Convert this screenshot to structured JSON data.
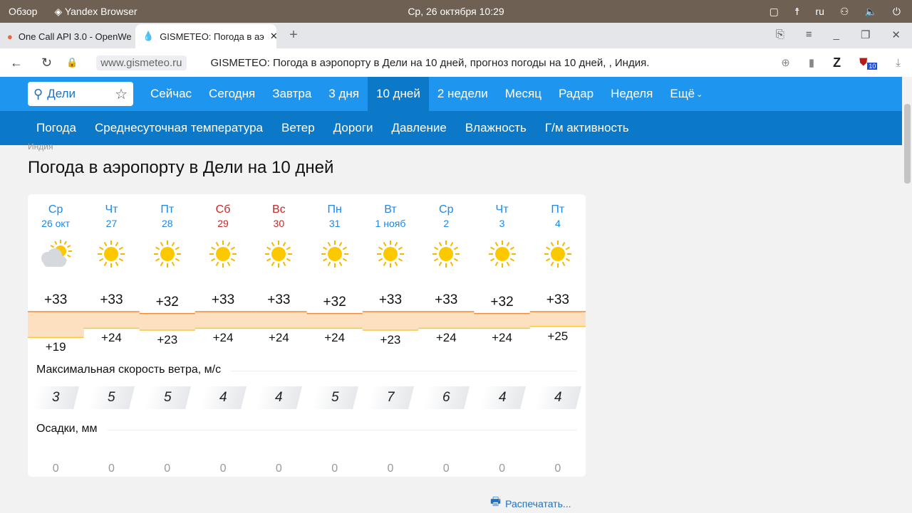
{
  "system": {
    "overview": "Обзор",
    "app": "Yandex Browser",
    "datetime": "Ср, 26 октября  10:29",
    "lang": "ru"
  },
  "tabs": [
    {
      "label": "One Call API 3.0 - OpenWe"
    },
    {
      "label": "GISMETEO: Погода в аэ"
    }
  ],
  "address": {
    "url": "www.gismeteo.ru",
    "page_title": "GISMETEO: Погода в аэропорту в Дели на 10 дней, прогноз погоды на 10 дней, , Индия.",
    "ext_badge": "10",
    "ext_z": "Z"
  },
  "nav1": {
    "search_value": "Дели",
    "items": [
      "Сейчас",
      "Сегодня",
      "Завтра",
      "3 дня",
      "10 дней",
      "2 недели",
      "Месяц",
      "Радар",
      "Неделя",
      "Ещё"
    ],
    "selected": "10 дней"
  },
  "nav2": {
    "items": [
      "Погода",
      "Среднесуточная температура",
      "Ветер",
      "Дороги",
      "Давление",
      "Влажность",
      "Г/м активность"
    ]
  },
  "breadcrumb": "Индия",
  "title": "Погода в аэропорту в Дели на 10 дней",
  "forecast": {
    "days": [
      {
        "name": "Ср",
        "date": "26 окт",
        "weekend": false,
        "icon": "partly-cloudy-icon",
        "tmax": "+33",
        "tmin": "+19",
        "wind": "3",
        "precip": "0"
      },
      {
        "name": "Чт",
        "date": "27",
        "weekend": false,
        "icon": "sun-icon",
        "tmax": "+33",
        "tmin": "+24",
        "wind": "5",
        "precip": "0"
      },
      {
        "name": "Пт",
        "date": "28",
        "weekend": false,
        "icon": "sun-icon",
        "tmax": "+32",
        "tmin": "+23",
        "wind": "5",
        "precip": "0"
      },
      {
        "name": "Сб",
        "date": "29",
        "weekend": true,
        "icon": "sun-icon",
        "tmax": "+33",
        "tmin": "+24",
        "wind": "4",
        "precip": "0"
      },
      {
        "name": "Вс",
        "date": "30",
        "weekend": true,
        "icon": "sun-icon",
        "tmax": "+33",
        "tmin": "+24",
        "wind": "4",
        "precip": "0"
      },
      {
        "name": "Пн",
        "date": "31",
        "weekend": false,
        "icon": "sun-icon",
        "tmax": "+32",
        "tmin": "+24",
        "wind": "5",
        "precip": "0"
      },
      {
        "name": "Вт",
        "date": "1 нояб",
        "weekend": false,
        "icon": "sun-icon",
        "tmax": "+33",
        "tmin": "+23",
        "wind": "7",
        "precip": "0"
      },
      {
        "name": "Ср",
        "date": "2",
        "weekend": false,
        "icon": "sun-icon",
        "tmax": "+33",
        "tmin": "+24",
        "wind": "6",
        "precip": "0"
      },
      {
        "name": "Чт",
        "date": "3",
        "weekend": false,
        "icon": "sun-icon",
        "tmax": "+32",
        "tmin": "+24",
        "wind": "4",
        "precip": "0"
      },
      {
        "name": "Пт",
        "date": "4",
        "weekend": false,
        "icon": "sun-icon",
        "tmax": "+33",
        "tmin": "+25",
        "wind": "4",
        "precip": "0"
      }
    ],
    "wind_label": "Максимальная скорость ветра, м/с",
    "precip_label": "Осадки, мм"
  },
  "print_label": "Распечатать...",
  "colors": {
    "brand": "#1e96f0",
    "nav2": "#0b78c8",
    "weekend": "#c62828",
    "band": "#fde0c0"
  }
}
